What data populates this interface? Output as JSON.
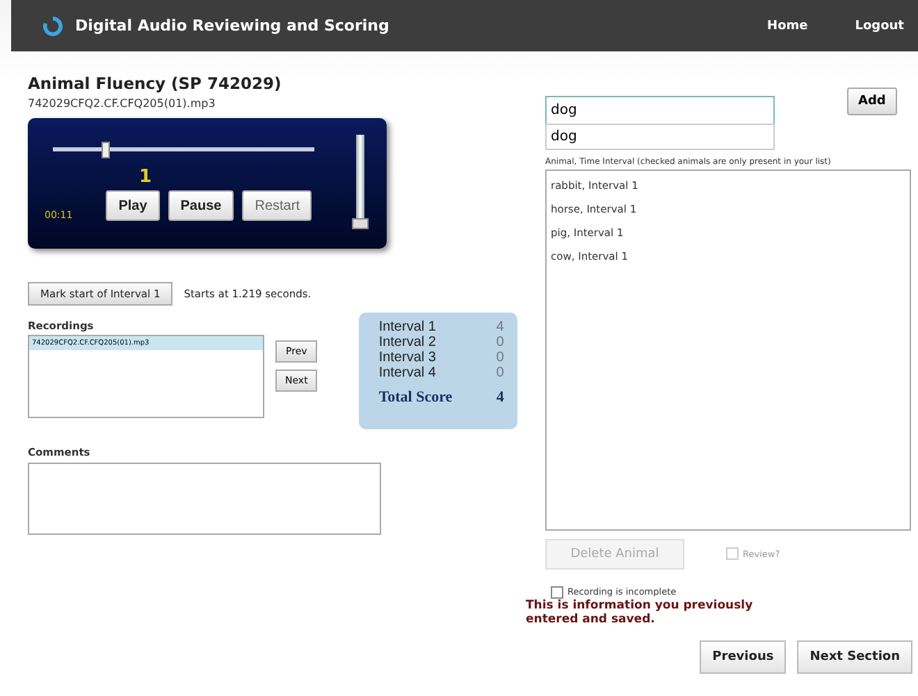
{
  "header": {
    "title": "Digital Audio Reviewing and Scoring",
    "nav": [
      "Home",
      "Logout"
    ]
  },
  "page": {
    "title": "Animal Fluency (SP 742029)",
    "file": "742029CFQ2.CF.CFQ205(01).mp3"
  },
  "player": {
    "position": {
      "level": 0.19
    },
    "marker": "1",
    "time": "00:11",
    "volume": {
      "level": 0.0
    },
    "buttons": [
      {
        "label": "Play",
        "disabled": false
      },
      {
        "label": "Pause",
        "disabled": false
      },
      {
        "label": "Restart",
        "disabled": true
      }
    ]
  },
  "interval": {
    "button": "Mark start of Interval 1",
    "note": "Starts at 1.219 seconds."
  },
  "recordings": {
    "label": "Recordings",
    "items": [
      {
        "name": "742029CFQ2.CF.CFQ205(01).mp3",
        "selected": true
      }
    ],
    "buttons": [
      "Prev",
      "Next"
    ]
  },
  "scores": {
    "rows": [
      {
        "label": "Interval 1",
        "value": "4"
      },
      {
        "label": "Interval 2",
        "value": "0"
      },
      {
        "label": "Interval 3",
        "value": "0"
      },
      {
        "label": "Interval 4",
        "value": "0"
      }
    ],
    "total_label": "Total Score",
    "total": "4"
  },
  "comments": {
    "label": "Comments"
  },
  "animal_entry": {
    "value": "dog",
    "suggestions": [
      "dog"
    ],
    "add_button": "Add"
  },
  "animals": {
    "label": "Animal, Time Interval (checked animals are only present in your list)",
    "items": [
      "rabbit, Interval 1",
      "horse, Interval 1",
      "pig, Interval 1",
      "cow, Interval 1"
    ]
  },
  "delete_button": {
    "label": "Delete Animal",
    "disabled": true
  },
  "review": {
    "label": "Review?",
    "checked": false,
    "disabled": true
  },
  "incomplete": {
    "label": "Recording is incomplete",
    "checked": false
  },
  "saved_note": "This is information you previously entered and saved.",
  "footer_buttons": [
    "Previous",
    "Next Section"
  ]
}
